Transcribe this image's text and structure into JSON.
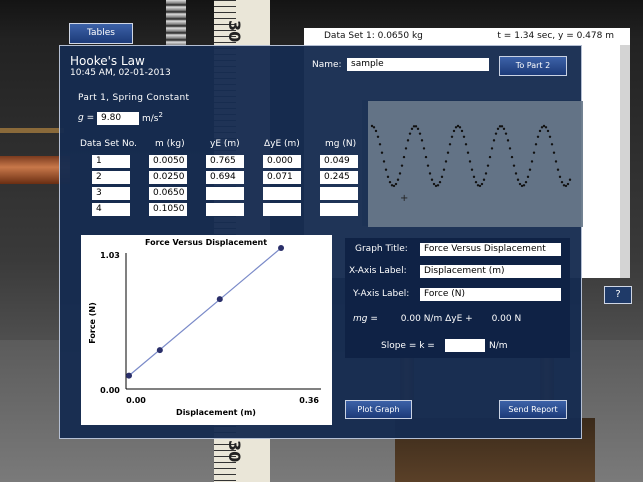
{
  "app": {
    "title": "Hooke's Law",
    "datetime": "10:45 AM, 02-01-2013",
    "tables_button": "Tables",
    "help_button": "?"
  },
  "sim": {
    "ruler_top": "30",
    "ruler_bottom": "30",
    "graph_header_left": "Data Set 1: 0.0650 kg",
    "graph_header_right": "t = 1.34 sec, y = 0.478 m",
    "cursor": "+"
  },
  "name": {
    "label": "Name:",
    "value": "sample"
  },
  "to_part2_button": "To Part 2",
  "part1": {
    "title": "Part 1, Spring Constant",
    "g_label": "g =",
    "g_value": "9.80",
    "g_unit": "m/s",
    "g_unit_sup": "2"
  },
  "table": {
    "headers": [
      "Data Set No.",
      "m (kg)",
      "yE (m)",
      "ΔyE (m)",
      "mg (N)"
    ],
    "rows": [
      [
        "1",
        "0.0050",
        "0.765",
        "0.000",
        "0.049"
      ],
      [
        "2",
        "0.0250",
        "0.694",
        "0.071",
        "0.245"
      ],
      [
        "3",
        "0.0650",
        "",
        "",
        ""
      ],
      [
        "4",
        "0.1050",
        "",
        "",
        ""
      ]
    ]
  },
  "chart_data": {
    "type": "scatter",
    "title": "Force Versus Displacement",
    "xlabel": "Displacement (m)",
    "ylabel": "Force (N)",
    "xlim": [
      0.0,
      0.36
    ],
    "ylim": [
      0.0,
      1.03
    ],
    "x_tick_labels": [
      "0.00",
      "0.36"
    ],
    "y_tick_labels": [
      "0.00",
      "1.03"
    ],
    "points": [
      {
        "x": 0.0,
        "y": 0.049
      },
      {
        "x": 0.071,
        "y": 0.245
      },
      {
        "x": 0.209,
        "y": 0.637
      },
      {
        "x": 0.35,
        "y": 1.03
      }
    ],
    "fit_line": {
      "x": [
        0.0,
        0.35
      ],
      "y": [
        0.049,
        1.03
      ]
    }
  },
  "form": {
    "graph_title_label": "Graph Title:",
    "graph_title_value": "Force Versus Displacement",
    "x_axis_label": "X-Axis Label:",
    "x_axis_value": "Displacement (m)",
    "y_axis_label": "Y-Axis Label:",
    "y_axis_value": "Force (N)",
    "eq_mg": "mg =",
    "eq_val1": "0.00",
    "eq_unit1": "N/m",
    "eq_delta": "ΔyE +",
    "eq_val2": "0.00",
    "eq_unit2": "N",
    "slope_label": "Slope = k =",
    "slope_value": "",
    "slope_unit": "N/m"
  },
  "plot_graph_button": "Plot Graph",
  "send_report_button": "Send Report"
}
